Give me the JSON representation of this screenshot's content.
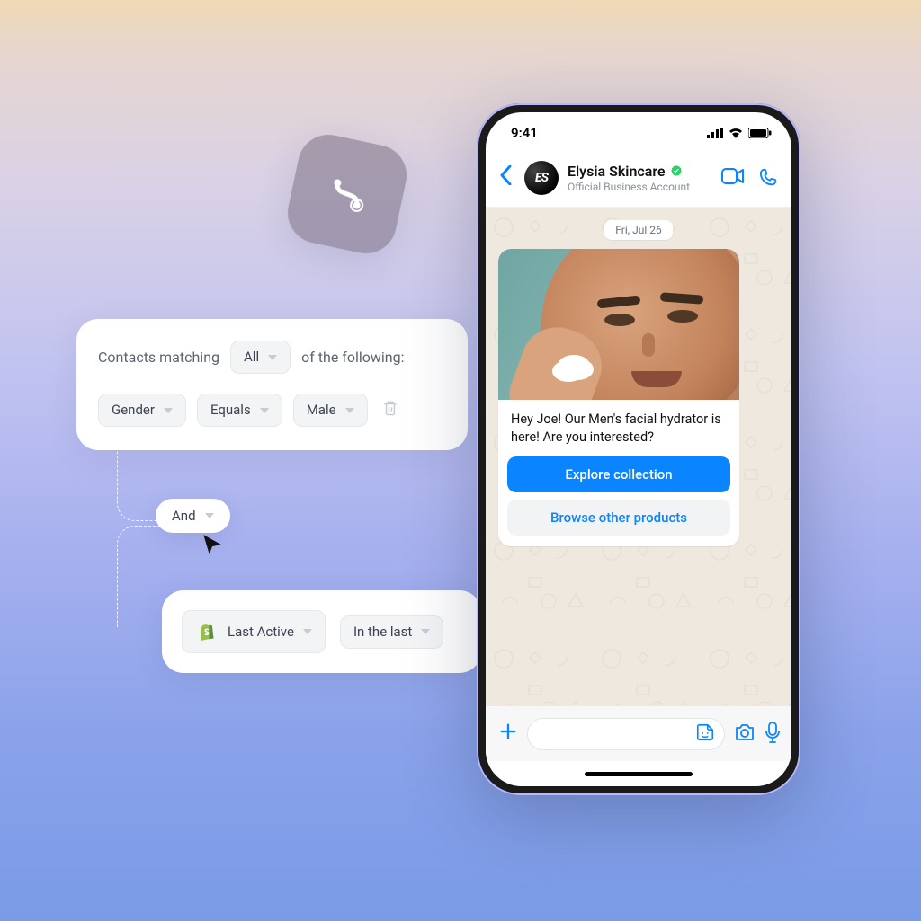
{
  "filter": {
    "lead_in": "Contacts matching",
    "match_mode": "All",
    "lead_out": "of the following:",
    "row": {
      "field": "Gender",
      "operator": "Equals",
      "value": "Male"
    }
  },
  "logic": {
    "operator": "And"
  },
  "second_rule": {
    "icon_name": "shopify",
    "field": "Last Active",
    "operator": "In the last"
  },
  "phone": {
    "time": "9:41",
    "contact": {
      "name": "Elysia Skincare",
      "subtitle": "Official Business Account",
      "avatar_initials": "ES"
    },
    "date_label": "Fri, Jul 26",
    "message": {
      "text": "Hey Joe! Our Men's facial hydrator is here! Are you interested?",
      "primary_button": "Explore collection",
      "secondary_button": "Browse other products"
    }
  }
}
